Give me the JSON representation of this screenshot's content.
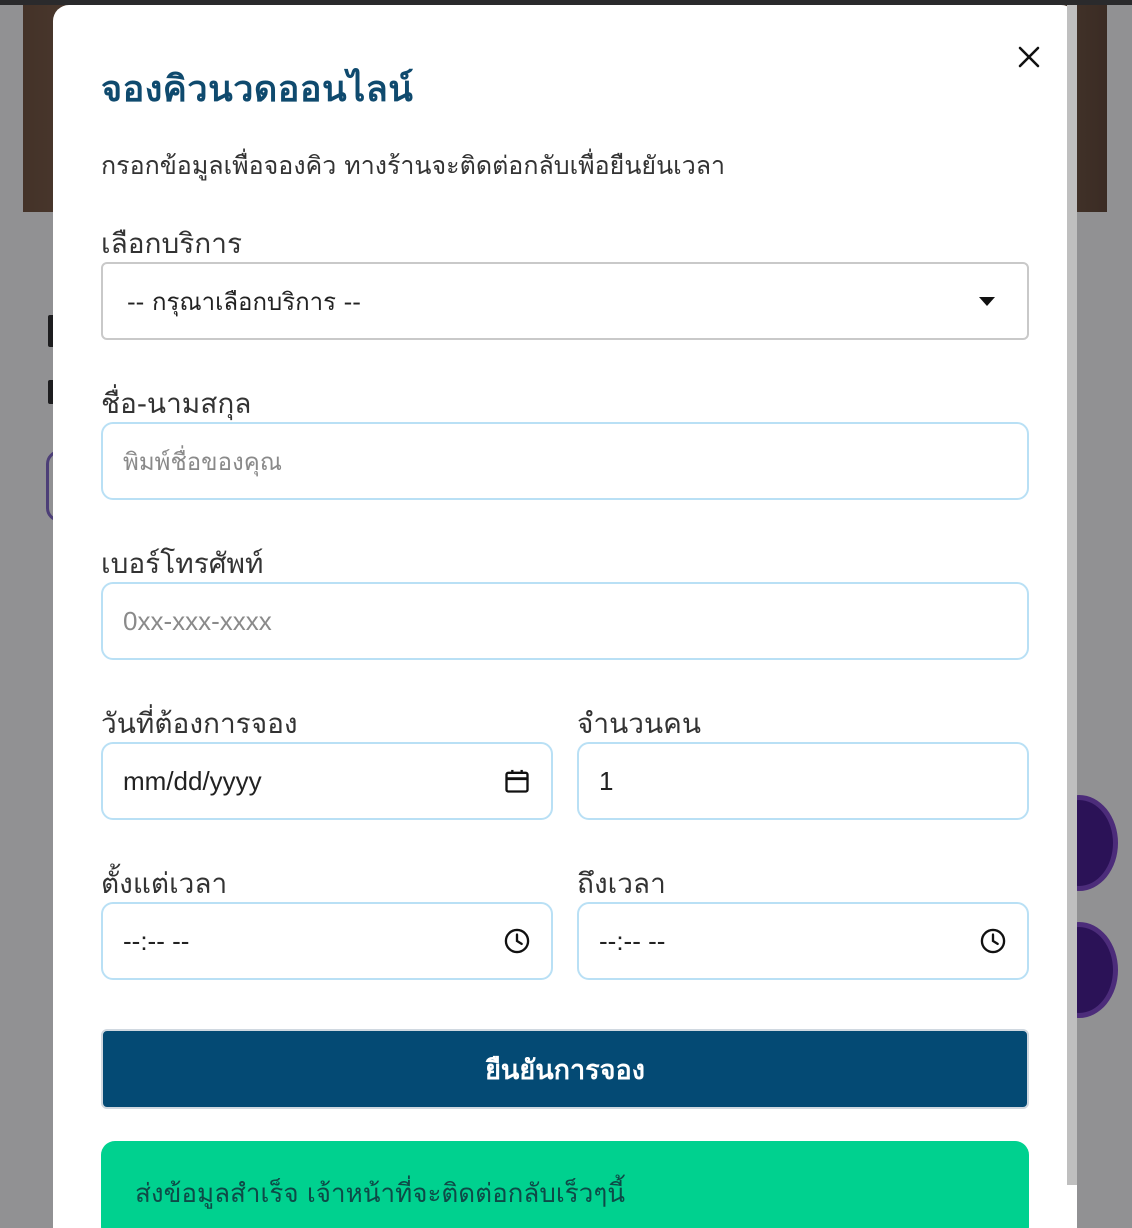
{
  "modal": {
    "title": "จองคิวนวดออนไลน์",
    "subtitle": "กรอกข้อมูลเพื่อจองคิว ทางร้านจะติดต่อกลับเพื่อยืนยันเวลา",
    "close_icon": "close-icon"
  },
  "form": {
    "service": {
      "label": "เลือกบริการ",
      "selected": "-- กรุณาเลือกบริการ --"
    },
    "name": {
      "label": "ชื่อ-นามสกุล",
      "placeholder": "พิมพ์ชื่อของคุณ"
    },
    "phone": {
      "label": "เบอร์โทรศัพท์",
      "placeholder": "0xx-xxx-xxxx"
    },
    "date": {
      "label": "วันที่ต้องการจอง",
      "value": "mm/dd/yyyy",
      "icon": "calendar-icon"
    },
    "people": {
      "label": "จำนวนคน",
      "value": "1"
    },
    "time_from": {
      "label": "ตั้งแต่เวลา",
      "value": "--:-- --",
      "icon": "clock-icon"
    },
    "time_to": {
      "label": "ถึงเวลา",
      "value": "--:-- --",
      "icon": "clock-icon"
    },
    "submit_label": "ยืนยันการจอง"
  },
  "status": {
    "success_message": "ส่งข้อมูลสำเร็จ เจ้าหน้าที่จะติดต่อกลับเร็วๆนี้"
  },
  "colors": {
    "title": "#0f4a6e",
    "submit_bg": "#044a74",
    "success_bg": "#00d18f",
    "field_border": "#b9e0f5"
  }
}
